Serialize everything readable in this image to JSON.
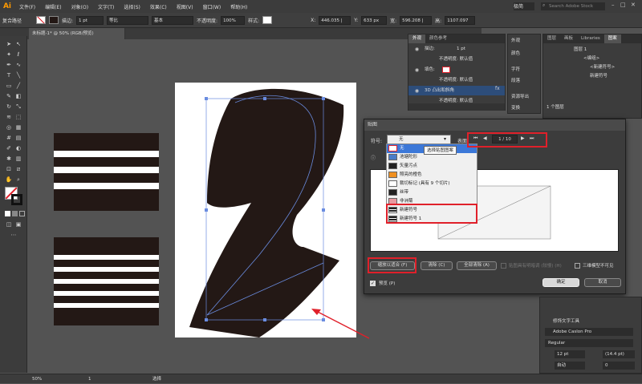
{
  "app": {
    "logo": "Ai"
  },
  "menu": [
    "文件(F)",
    "编辑(E)",
    "对象(O)",
    "文字(T)",
    "选择(S)",
    "效果(C)",
    "视图(V)",
    "窗口(W)",
    "帮助(H)"
  ],
  "topright": {
    "workspace": "极简",
    "search_placeholder": "Search Adobe Stock"
  },
  "control": {
    "path_label": "复合路径",
    "stroke_label": "描边:",
    "stroke_weight": "1 pt",
    "stroke_style": "等比",
    "brush": "基本",
    "opacity_label": "不透明度:",
    "opacity": "100%",
    "style_label": "样式:",
    "x_label": "X:",
    "x": "446.035 |",
    "y_label": "Y:",
    "y": "633 px",
    "w_label": "宽:",
    "w": "596.208 |",
    "h_label": "高:",
    "h": "1107.097"
  },
  "doc_tab": "未标题-1* @ 50% (RGB/预览)",
  "status": {
    "zoom": "50%",
    "page": "1",
    "mode": "选择"
  },
  "appearance": {
    "tabs": [
      "外观",
      "颜色参考"
    ],
    "rows": [
      "描边:",
      "1 pt",
      "不透明度: 默认值",
      "填色:",
      "不透明度: 默认值",
      "3D 凸出和斜角",
      "不透明度: 默认值"
    ],
    "fx": "fx"
  },
  "mini_panels": [
    "外观",
    "颜色",
    "字符",
    "段落",
    "资源导出",
    "变换"
  ],
  "layers": {
    "tabs": [
      "图层",
      "画板",
      "Libraries",
      "图案"
    ],
    "items": [
      "图层 1",
      "<编组>",
      "<新建符号>",
      "新建符号"
    ],
    "footer": "1 个图层"
  },
  "map_dialog": {
    "title": "贴图",
    "symbol_label": "符号:",
    "symbol_value": "无",
    "surface_label": "表面:",
    "surface_value": "1 / 10",
    "tooltip": "选择贴图图案",
    "options": [
      "无",
      "池塘陀形",
      "矢量污点",
      "照亮的橙色",
      "裁切标记 (具有 9 个切片)",
      "丝带",
      "非洲菊",
      "新建符号",
      "新建符号 1"
    ],
    "scale_btn": "缩放以适合 (F)",
    "clear_btn": "清除 (C)",
    "clear_all_btn": "全部清除 (A)",
    "shade_label": "贴图具有明暗调 (较慢) (H)",
    "invisible_label": "三维模型不可见",
    "preview_label": "预览 (P)",
    "ok": "确定",
    "cancel": "取消"
  },
  "char_panel": {
    "tool": "修饰文字工具",
    "font": "Adobe Caslon Pro",
    "style": "Regular",
    "size": "12 pt",
    "leading": "(14.4 pt)",
    "scale": "100%",
    "kerning": "自动",
    "tracking": "0"
  },
  "colors": {
    "red": "#e0202a",
    "art": "#231815",
    "accent": "#ff9a00"
  }
}
